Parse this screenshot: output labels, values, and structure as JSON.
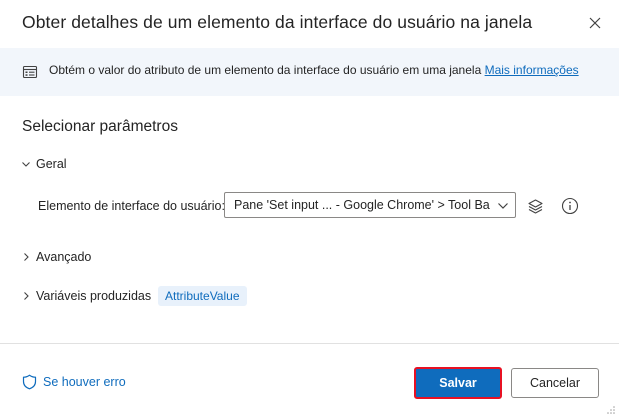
{
  "dialog": {
    "title": "Obter detalhes de um elemento da interface do usuário na janela",
    "close_icon": "close-icon"
  },
  "info": {
    "text": "Obtém o valor do atributo de um elemento da interface do usuário em uma janela",
    "link": "Mais informações",
    "icon": "info-list-icon"
  },
  "params": {
    "section_title": "Selecionar parâmetros",
    "general_label": "Geral",
    "ui_element_label": "Elemento de interface do usuário:",
    "ui_element_value": "Pane 'Set input  ...  - Google Chrome' > Tool Bar",
    "advanced_label": "Avançado",
    "variables_label": "Variáveis produzidas",
    "variable_chip": "AttributeValue"
  },
  "footer": {
    "on_error": "Se houver erro",
    "save": "Salvar",
    "cancel": "Cancelar"
  },
  "colors": {
    "accent": "#0f6cbd",
    "banner_bg": "#f2f6fb",
    "highlight_border": "#e81123"
  }
}
